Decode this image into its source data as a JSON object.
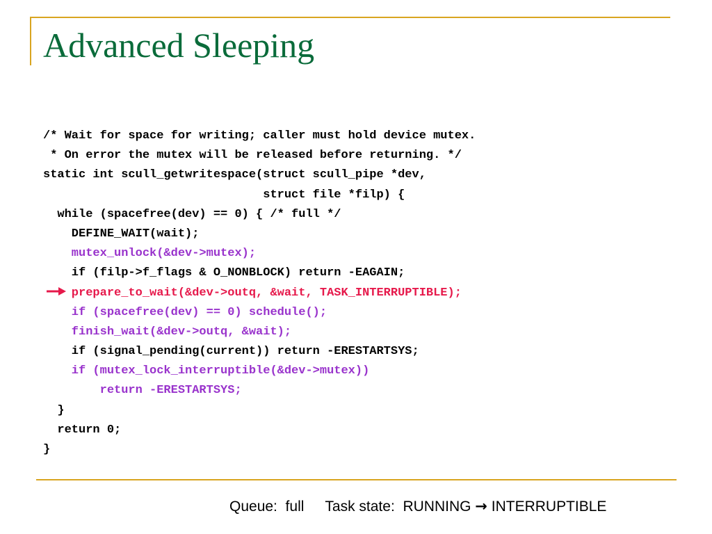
{
  "slide": {
    "title": "Advanced Sleeping"
  },
  "code_lines": [
    {
      "text": "/* Wait for space for writing; caller must hold device mutex.",
      "style": "normal"
    },
    {
      "text": " * On error the mutex will be released before returning. */",
      "style": "normal"
    },
    {
      "text": "static int scull_getwritespace(struct scull_pipe *dev,",
      "style": "normal"
    },
    {
      "text": "                               struct file *filp) {",
      "style": "normal"
    },
    {
      "text": "  while (spacefree(dev) == 0) { /* full */",
      "style": "normal"
    },
    {
      "text": "    DEFINE_WAIT(wait);",
      "style": "normal"
    },
    {
      "text": "    mutex_unlock(&dev->mutex);",
      "style": "purple"
    },
    {
      "text": "    if (filp->f_flags & O_NONBLOCK) return -EAGAIN;",
      "style": "normal"
    },
    {
      "text": "    prepare_to_wait(&dev->outq, &wait, TASK_INTERRUPTIBLE);",
      "style": "red"
    },
    {
      "text": "    if (spacefree(dev) == 0) schedule();",
      "style": "purple"
    },
    {
      "text": "    finish_wait(&dev->outq, &wait);",
      "style": "purple"
    },
    {
      "text": "    if (signal_pending(current)) return -ERESTARTSYS;",
      "style": "normal"
    },
    {
      "text": "    if (mutex_lock_interruptible(&dev->mutex))",
      "style": "purple"
    },
    {
      "text": "        return -ERESTARTSYS;",
      "style": "purple"
    },
    {
      "text": "  }",
      "style": "normal"
    },
    {
      "text": "  return 0;",
      "style": "normal"
    },
    {
      "text": "}",
      "style": "normal"
    }
  ],
  "pointer": {
    "icon": "right-arrow-icon",
    "color": "#e6194b"
  },
  "footer": {
    "queue_label": "Queue:  full",
    "task_state_label": "Task state:  RUNNING ",
    "arrow_glyph": "→",
    "task_state_value": " INTERRUPTIBLE"
  },
  "colors": {
    "title": "#0a6b3a",
    "accent_rule": "#d9a520",
    "highlight_purple": "#9933cc",
    "highlight_red": "#e6194b"
  }
}
